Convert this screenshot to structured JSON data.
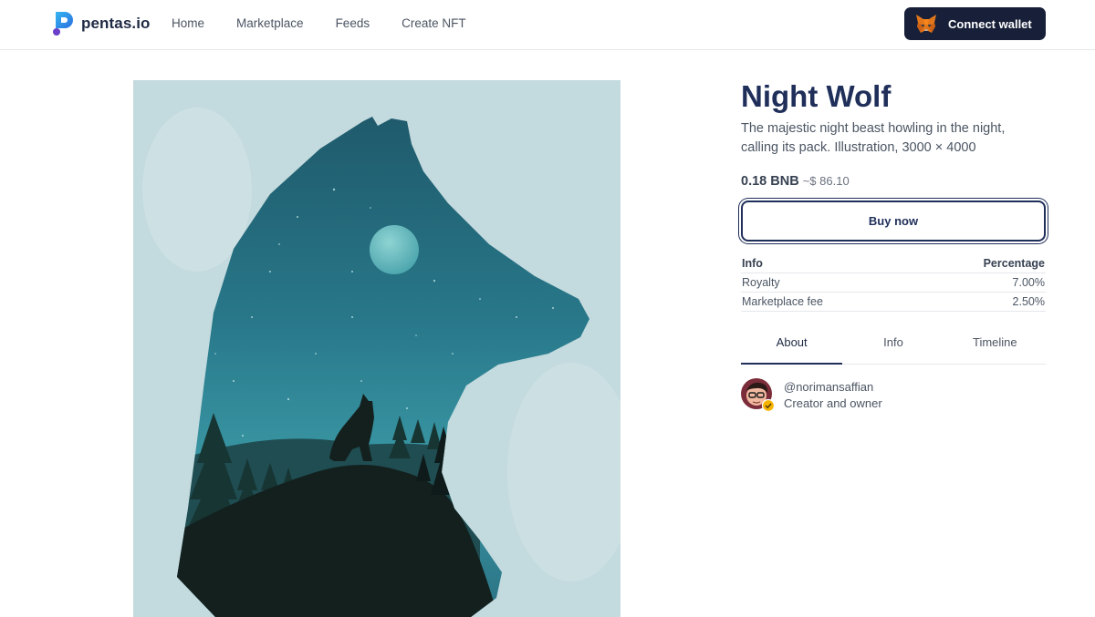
{
  "header": {
    "brand": "pentas.io",
    "nav": [
      {
        "label": "Home"
      },
      {
        "label": "Marketplace"
      },
      {
        "label": "Feeds"
      },
      {
        "label": "Create NFT"
      }
    ],
    "connect_label": "Connect wallet",
    "connect_icon": "metamask-fox-icon"
  },
  "nft": {
    "title": "Night Wolf",
    "description": "The majestic night beast howling in the night, calling its pack. Illustration, 3000 × 4000",
    "price_crypto": "0.18 BNB",
    "price_fiat": "~$ 86.10",
    "buy_label": "Buy now"
  },
  "fees": {
    "headers": [
      "Info",
      "Percentage"
    ],
    "rows": [
      {
        "label": "Royalty",
        "value": "7.00%"
      },
      {
        "label": "Marketplace fee",
        "value": "2.50%"
      }
    ]
  },
  "tabs": [
    {
      "label": "About",
      "active": true
    },
    {
      "label": "Info",
      "active": false
    },
    {
      "label": "Timeline",
      "active": false
    }
  ],
  "owner": {
    "handle": "@norimansaffian",
    "role": "Creator and owner",
    "verified": true
  },
  "colors": {
    "brand_dark": "#172038",
    "title": "#1f2f5a",
    "background_art": "#c9dfe2",
    "art_sky": "#2a7f8f",
    "art_ground": "#13201e"
  }
}
